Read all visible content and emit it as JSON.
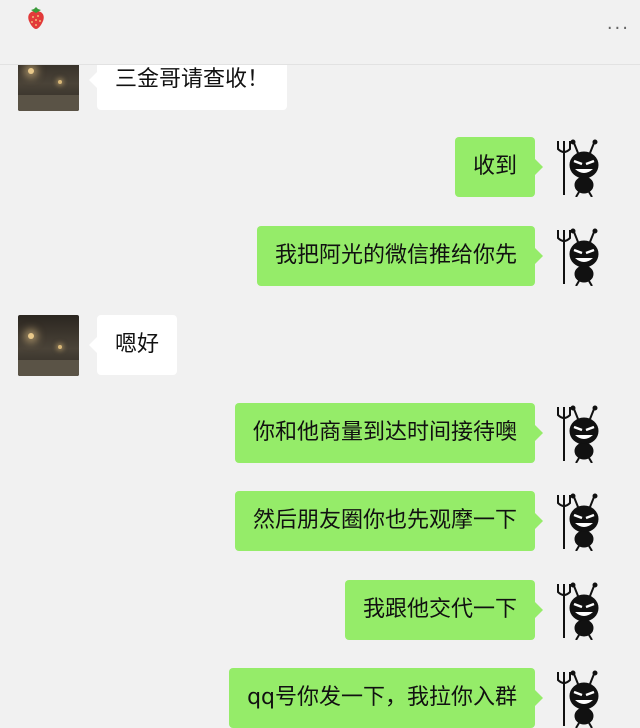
{
  "header": {
    "contact_icon": "strawberry-icon",
    "more_label": "···"
  },
  "colors": {
    "background": "#f1f1f1",
    "self_bubble": "#95ec69",
    "other_bubble": "#ffffff"
  },
  "messages": [
    {
      "side": "left",
      "text": "三金哥请查收！"
    },
    {
      "side": "right",
      "text": "收到"
    },
    {
      "side": "right",
      "text": "我把阿光的微信推给你先"
    },
    {
      "side": "left",
      "text": "嗯好"
    },
    {
      "side": "right",
      "text": "你和他商量到达时间接待噢"
    },
    {
      "side": "right",
      "text": "然后朋友圈你也先观摩一下"
    },
    {
      "side": "right",
      "text": "我跟他交代一下"
    },
    {
      "side": "right",
      "text": "qq号你发一下，我拉你入群"
    }
  ]
}
